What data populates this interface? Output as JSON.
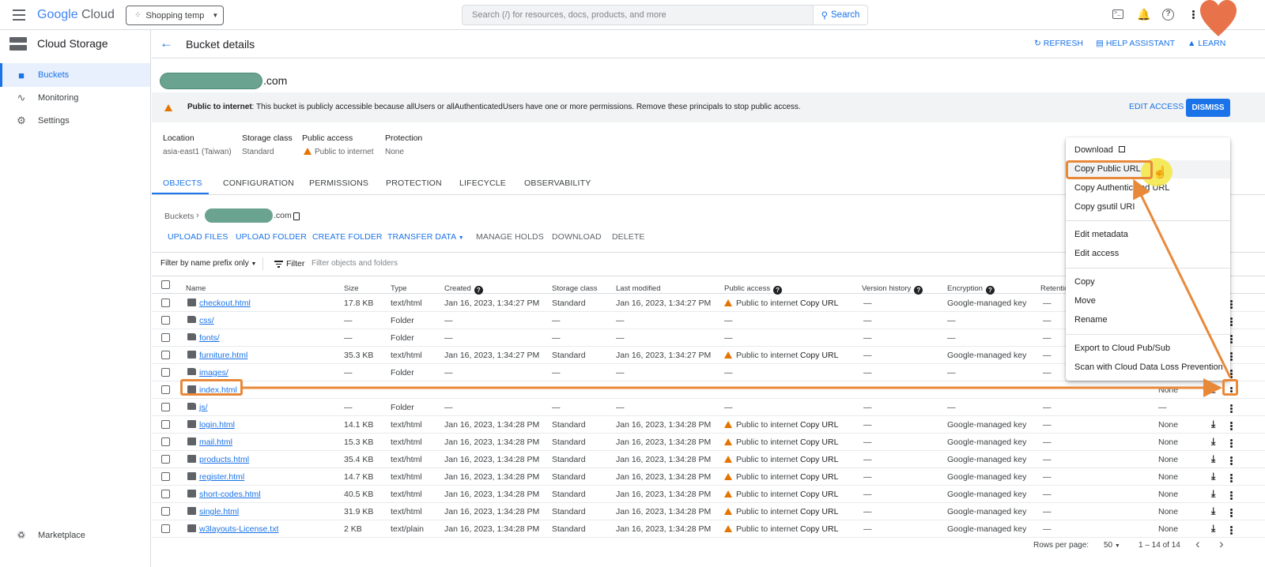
{
  "topbar": {
    "logo_google": "Google",
    "logo_cloud": "Cloud",
    "project": "Shopping temp",
    "search_placeholder": "Search (/) for resources, docs, products, and more",
    "search_button": "Search"
  },
  "sidebar": {
    "title": "Cloud Storage",
    "items": [
      {
        "label": "Buckets",
        "icon": "bucket-icon"
      },
      {
        "label": "Monitoring",
        "icon": "chart-icon"
      },
      {
        "label": "Settings",
        "icon": "gear-icon"
      }
    ],
    "footer": "Marketplace"
  },
  "header": {
    "title": "Bucket details",
    "refresh": "REFRESH",
    "help_assistant": "HELP ASSISTANT",
    "learn": "LEARN"
  },
  "bucket": {
    "name_suffix": ".com"
  },
  "banner": {
    "title": "Public to internet",
    "text": ": This bucket is publicly accessible because allUsers or allAuthenticatedUsers have one or more permissions. Remove these principals to stop public access.",
    "edit_access": "EDIT ACCESS",
    "dismiss": "DISMISS"
  },
  "info": [
    {
      "label": "Location",
      "value": "asia-east1 (Taiwan)"
    },
    {
      "label": "Storage class",
      "value": "Standard"
    },
    {
      "label": "Public access",
      "value": "Public to internet"
    },
    {
      "label": "Protection",
      "value": "None"
    }
  ],
  "tabs": [
    "OBJECTS",
    "CONFIGURATION",
    "PERMISSIONS",
    "PROTECTION",
    "LIFECYCLE",
    "OBSERVABILITY"
  ],
  "breadcrumb": {
    "root": "Buckets",
    "suffix": ".com"
  },
  "actions": [
    "UPLOAD FILES",
    "UPLOAD FOLDER",
    "CREATE FOLDER",
    "TRANSFER DATA",
    "MANAGE HOLDS",
    "DOWNLOAD",
    "DELETE"
  ],
  "filter": {
    "mode": "Filter by name prefix only",
    "label": "Filter",
    "placeholder": "Filter objects and folders"
  },
  "columns": [
    "Name",
    "Size",
    "Type",
    "Created",
    "Storage class",
    "Last modified",
    "Public access",
    "Version history",
    "Encryption",
    "Retentio"
  ],
  "rows": [
    {
      "name": "checkout.html",
      "kind": "file",
      "size": "17.8 KB",
      "type": "text/html",
      "created": "Jan 16, 2023, 1:34:27 PM",
      "storage": "Standard",
      "modified": "Jan 16, 2023, 1:34:27 PM",
      "public": "Public to internet",
      "copy": "Copy URL",
      "version": "—",
      "encryption": "Google-managed key",
      "retention": "—",
      "holds": ""
    },
    {
      "name": "css/",
      "kind": "folder",
      "size": "—",
      "type": "Folder",
      "created": "—",
      "storage": "—",
      "modified": "—",
      "public": "—",
      "copy": "",
      "version": "—",
      "encryption": "—",
      "retention": "—",
      "holds": ""
    },
    {
      "name": "fonts/",
      "kind": "folder",
      "size": "—",
      "type": "Folder",
      "created": "—",
      "storage": "—",
      "modified": "—",
      "public": "—",
      "copy": "",
      "version": "—",
      "encryption": "—",
      "retention": "—",
      "holds": ""
    },
    {
      "name": "furniture.html",
      "kind": "file",
      "size": "35.3 KB",
      "type": "text/html",
      "created": "Jan 16, 2023, 1:34:27 PM",
      "storage": "Standard",
      "modified": "Jan 16, 2023, 1:34:27 PM",
      "public": "Public to internet",
      "copy": "Copy URL",
      "version": "—",
      "encryption": "Google-managed key",
      "retention": "—",
      "holds": ""
    },
    {
      "name": "images/",
      "kind": "folder",
      "size": "—",
      "type": "Folder",
      "created": "—",
      "storage": "—",
      "modified": "—",
      "public": "—",
      "copy": "",
      "version": "—",
      "encryption": "—",
      "retention": "—",
      "holds": ""
    },
    {
      "name": "index.html",
      "kind": "file",
      "size": "",
      "type": "",
      "created": "",
      "storage": "",
      "modified": "",
      "public": "",
      "copy": "",
      "version": "",
      "encryption": "",
      "retention": "",
      "holds": "None"
    },
    {
      "name": "js/",
      "kind": "folder",
      "size": "—",
      "type": "Folder",
      "created": "—",
      "storage": "—",
      "modified": "—",
      "public": "—",
      "copy": "",
      "version": "—",
      "encryption": "—",
      "retention": "—",
      "holds": "—"
    },
    {
      "name": "login.html",
      "kind": "file",
      "size": "14.1 KB",
      "type": "text/html",
      "created": "Jan 16, 2023, 1:34:28 PM",
      "storage": "Standard",
      "modified": "Jan 16, 2023, 1:34:28 PM",
      "public": "Public to internet",
      "copy": "Copy URL",
      "version": "—",
      "encryption": "Google-managed key",
      "retention": "—",
      "holds": "None"
    },
    {
      "name": "mail.html",
      "kind": "file",
      "size": "15.3 KB",
      "type": "text/html",
      "created": "Jan 16, 2023, 1:34:28 PM",
      "storage": "Standard",
      "modified": "Jan 16, 2023, 1:34:28 PM",
      "public": "Public to internet",
      "copy": "Copy URL",
      "version": "—",
      "encryption": "Google-managed key",
      "retention": "—",
      "holds": "None"
    },
    {
      "name": "products.html",
      "kind": "file",
      "size": "35.4 KB",
      "type": "text/html",
      "created": "Jan 16, 2023, 1:34:28 PM",
      "storage": "Standard",
      "modified": "Jan 16, 2023, 1:34:28 PM",
      "public": "Public to internet",
      "copy": "Copy URL",
      "version": "—",
      "encryption": "Google-managed key",
      "retention": "—",
      "holds": "None"
    },
    {
      "name": "register.html",
      "kind": "file",
      "size": "14.7 KB",
      "type": "text/html",
      "created": "Jan 16, 2023, 1:34:28 PM",
      "storage": "Standard",
      "modified": "Jan 16, 2023, 1:34:28 PM",
      "public": "Public to internet",
      "copy": "Copy URL",
      "version": "—",
      "encryption": "Google-managed key",
      "retention": "—",
      "holds": "None"
    },
    {
      "name": "short-codes.html",
      "kind": "file",
      "size": "40.5 KB",
      "type": "text/html",
      "created": "Jan 16, 2023, 1:34:28 PM",
      "storage": "Standard",
      "modified": "Jan 16, 2023, 1:34:28 PM",
      "public": "Public to internet",
      "copy": "Copy URL",
      "version": "—",
      "encryption": "Google-managed key",
      "retention": "—",
      "holds": "None"
    },
    {
      "name": "single.html",
      "kind": "file",
      "size": "31.9 KB",
      "type": "text/html",
      "created": "Jan 16, 2023, 1:34:28 PM",
      "storage": "Standard",
      "modified": "Jan 16, 2023, 1:34:28 PM",
      "public": "Public to internet",
      "copy": "Copy URL",
      "version": "—",
      "encryption": "Google-managed key",
      "retention": "—",
      "holds": "None"
    },
    {
      "name": "w3layouts-License.txt",
      "kind": "file",
      "size": "2 KB",
      "type": "text/plain",
      "created": "Jan 16, 2023, 1:34:28 PM",
      "storage": "Standard",
      "modified": "Jan 16, 2023, 1:34:28 PM",
      "public": "Public to internet",
      "copy": "Copy URL",
      "version": "—",
      "encryption": "Google-managed key",
      "retention": "—",
      "holds": "None"
    }
  ],
  "pagination": {
    "label": "Rows per page:",
    "value": "50",
    "range": "1 – 14 of 14"
  },
  "menu": {
    "download": "Download",
    "copy_public_url": "Copy Public URL",
    "copy_authenticated_url": "Copy Authenticated URL",
    "copy_gsutil_uri": "Copy gsutil URI",
    "edit_metadata": "Edit metadata",
    "edit_access": "Edit access",
    "copy": "Copy",
    "move": "Move",
    "rename": "Rename",
    "export_pubsub": "Export to Cloud Pub/Sub",
    "scan_dlp": "Scan with Cloud Data Loss Prevention"
  },
  "colors": {
    "accent": "#1a73e8",
    "warning": "#e37400",
    "annotation": "#e8893a",
    "highlight": "#f5e642",
    "redacted": "#6aa390",
    "heart": "#e8734a"
  }
}
